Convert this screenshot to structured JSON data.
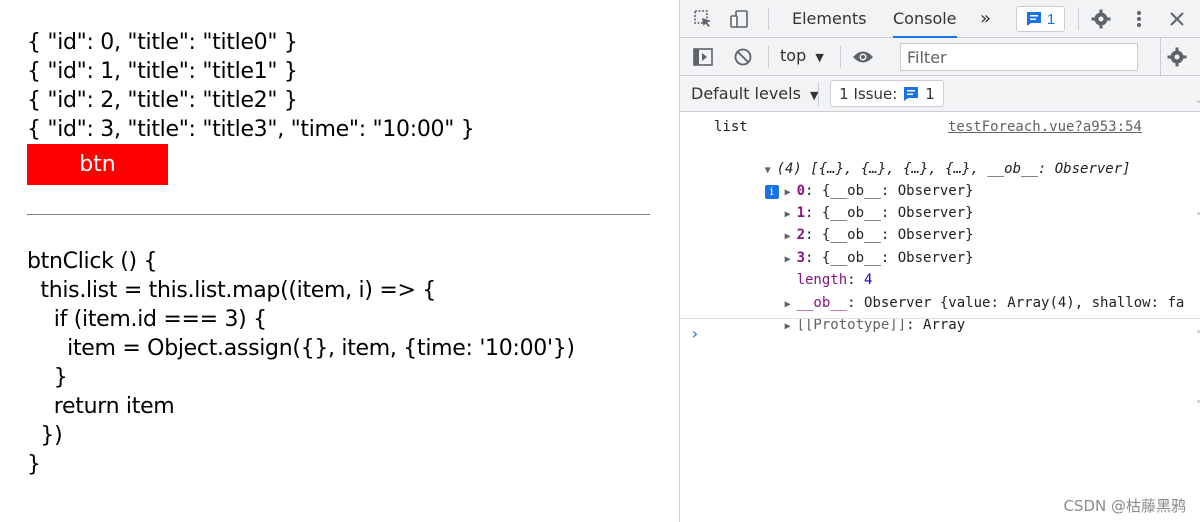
{
  "left": {
    "lines": [
      "{ \"id\": 0, \"title\": \"title0\" }",
      "{ \"id\": 1, \"title\": \"title1\" }",
      "{ \"id\": 2, \"title\": \"title2\" }",
      "{ \"id\": 3, \"title\": \"title3\", \"time\": \"10:00\" }"
    ],
    "button_label": "btn",
    "button_color": "#ff0000",
    "code": [
      "btnClick () {",
      "  this.list = this.list.map((item, i) => {",
      "    if (item.id === 3) {",
      "      item = Object.assign({}, item, {time: '10:00'})",
      "    }",
      "    return item",
      "  })",
      "}"
    ]
  },
  "devtools": {
    "tabs": [
      "Elements",
      "Console"
    ],
    "active_tab": "Console",
    "more_tabs_icon": "»",
    "messages_badge_count": "1",
    "context": "top",
    "filter_placeholder": "Filter",
    "levels_label": "Default levels",
    "issues_label": "1 Issue:",
    "issues_count": "1",
    "console": {
      "log_label": "list",
      "source": "testForeach.vue?a953:54",
      "summary": "(4) [{…}, {…}, {…}, {…}, __ob__: Observer]",
      "info_icon": "i",
      "items": [
        {
          "key": "0",
          "value": "{__ob__: Observer}"
        },
        {
          "key": "1",
          "value": "{__ob__: Observer}"
        },
        {
          "key": "2",
          "value": "{__ob__: Observer}"
        },
        {
          "key": "3",
          "value": "{__ob__: Observer}"
        }
      ],
      "length_key": "length",
      "length_value": "4",
      "ob_key": "__ob__",
      "ob_value": "Observer {value: Array(4), shallow: fa",
      "proto_key": "[[Prototype]]",
      "proto_value": "Array",
      "prompt": "›"
    },
    "accent_color": "#1a73e8"
  },
  "watermark": "CSDN @枯藤黑鸦"
}
